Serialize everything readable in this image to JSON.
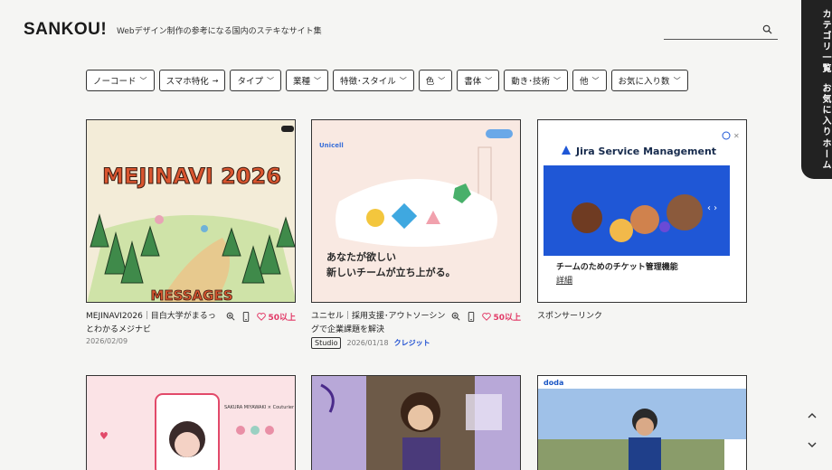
{
  "header": {
    "logo": "SANKOU!",
    "tagline": "Webデザイン制作の参考になる国内のステキなサイト集",
    "search_placeholder": ""
  },
  "side_tabs": [
    "カテゴリ一覧",
    "お気に入り",
    "ホーム"
  ],
  "filters": [
    {
      "label": "ノーコード",
      "icon": "chevron-down"
    },
    {
      "label": "スマホ特化",
      "icon": "arrow-right"
    },
    {
      "label": "タイプ",
      "icon": "chevron-down"
    },
    {
      "label": "業種",
      "icon": "chevron-down"
    },
    {
      "label": "特徴･スタイル",
      "icon": "chevron-down"
    },
    {
      "label": "色",
      "icon": "chevron-down"
    },
    {
      "label": "書体",
      "icon": "chevron-down"
    },
    {
      "label": "動き･技術",
      "icon": "chevron-down"
    },
    {
      "label": "他",
      "icon": "chevron-down"
    },
    {
      "label": "お気に入り数",
      "icon": "chevron-down"
    }
  ],
  "cards": [
    {
      "title": "MEJINAVI2026｜目白大学がまるっとわかるメジナビ",
      "likes": "50以上",
      "date": "2026/02/09",
      "thumb": {
        "headline": "MEJINAVI 2026",
        "footer": "MESSAGES",
        "bg": "#f3ecd8",
        "accent": "#d9552f"
      }
    },
    {
      "title": "ユニセル｜採用支援･アウトソーシングで企業課題を解決",
      "likes": "50以上",
      "tag": "Studio",
      "date": "2026/01/18",
      "credit": "クレジット",
      "thumb": {
        "brand": "Unicell",
        "line1": "あなたが欲しい",
        "line2": "新しいチームが立ち上がる。",
        "bg": "#f9e9e2"
      }
    },
    {
      "title": "スポンサーリンク",
      "ad": {
        "brand": "Jira Service Management",
        "caption": "チームのためのチケット管理機能",
        "link": "詳細",
        "accent": "#1f57d6"
      }
    },
    {
      "thumb": {
        "bg": "#fbe3e6",
        "text": "SAKURA MIYAWAKI × Couturier"
      }
    },
    {
      "thumb": {
        "bg": "#b8a8d8"
      }
    },
    {
      "thumb": {
        "bg": "#e6ecf5",
        "brand": "doda"
      }
    }
  ]
}
